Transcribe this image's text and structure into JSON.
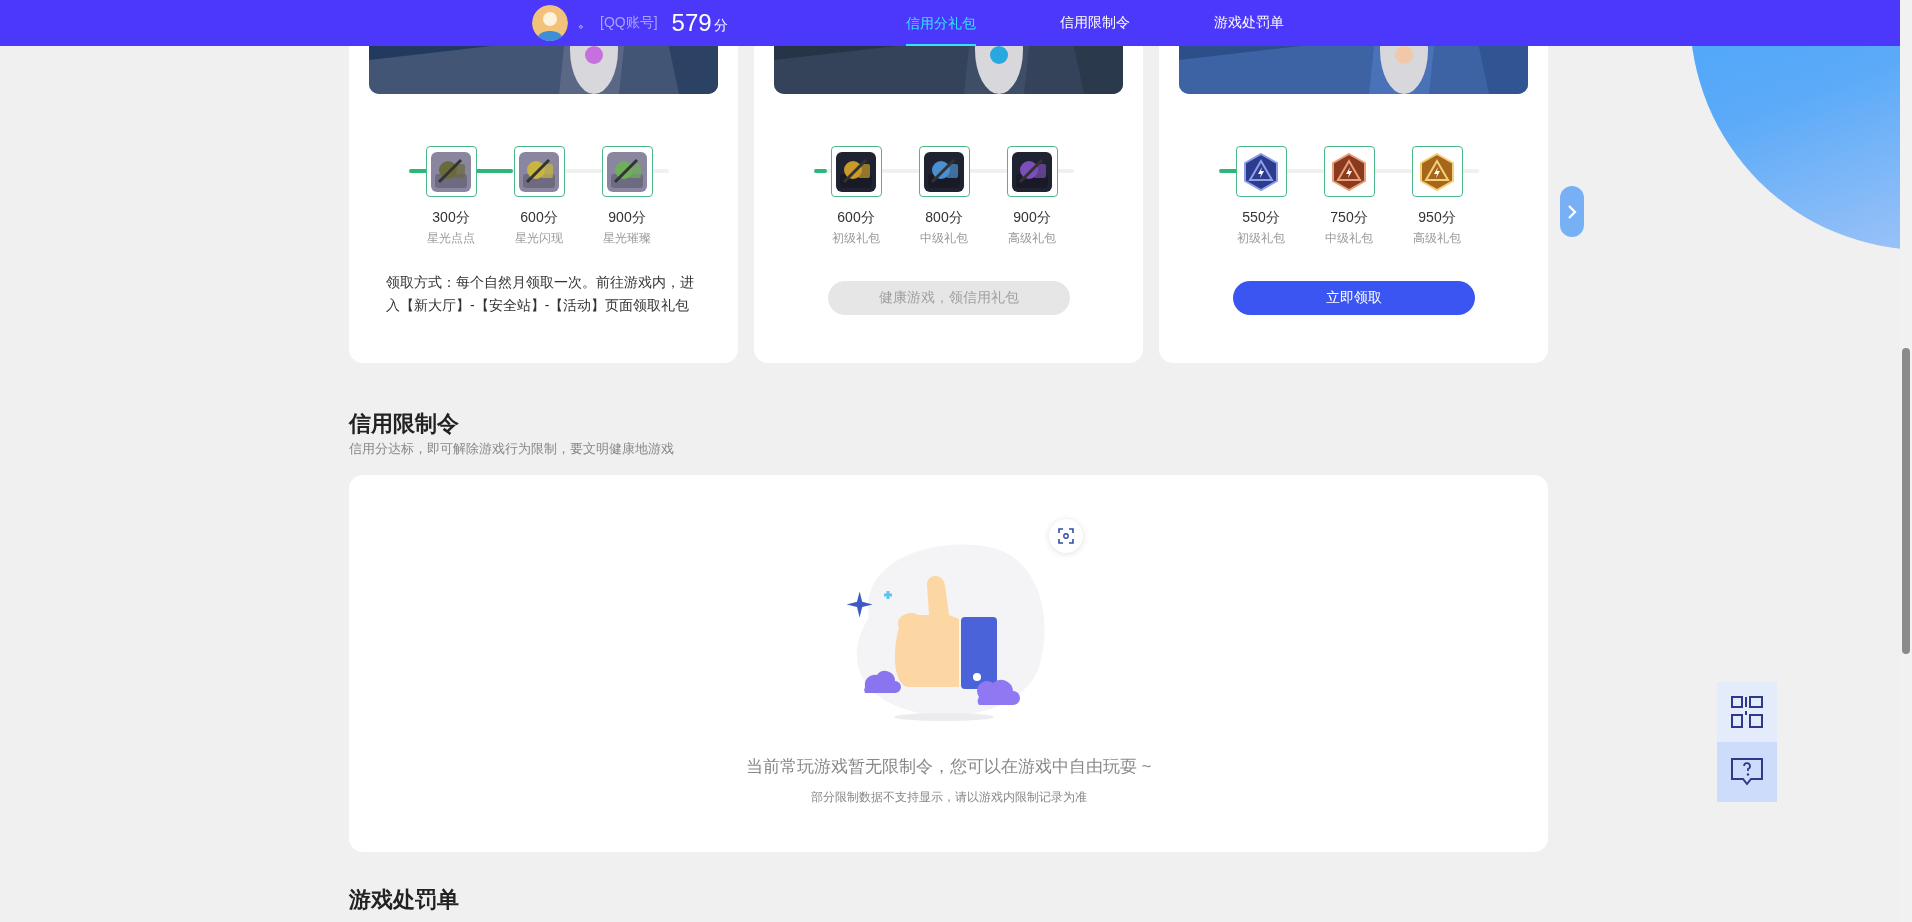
{
  "header": {
    "account_mark": "。",
    "account_label": "[QQ账号]",
    "score": "579",
    "score_unit": "分",
    "tabs": [
      {
        "label": "信用分礼包",
        "selected": true
      },
      {
        "label": "信用限制令",
        "selected": false
      },
      {
        "label": "游戏处罚单",
        "selected": false
      }
    ]
  },
  "gift_cards": [
    {
      "level": 0.4,
      "rewards": [
        {
          "score": "300分",
          "name": "星光点点"
        },
        {
          "score": "600分",
          "name": "星光闪现"
        },
        {
          "score": "900分",
          "name": "星光璀璨"
        }
      ],
      "note": "领取方式：每个自然月领取一次。前往游戏内，进入【新大厅】-【安全站】-【活动】页面领取礼包"
    },
    {
      "level": 0.05,
      "rewards": [
        {
          "score": "600分",
          "name": "初级礼包"
        },
        {
          "score": "800分",
          "name": "中级礼包"
        },
        {
          "score": "900分",
          "name": "高级礼包"
        }
      ],
      "button": {
        "label": "健康游戏，领信用礼包",
        "disabled": true
      }
    },
    {
      "level": 0.26,
      "rewards": [
        {
          "score": "550分",
          "name": "初级礼包"
        },
        {
          "score": "750分",
          "name": "中级礼包"
        },
        {
          "score": "950分",
          "name": "高级礼包"
        }
      ],
      "button": {
        "label": "立即领取",
        "disabled": false
      }
    }
  ],
  "limit_section": {
    "title": "信用限制令",
    "subtitle": "信用分达标，即可解除游戏行为限制，要文明健康地游戏",
    "empty_message": "当前常玩游戏暂无限制令，您可以在游戏中自由玩耍 ~",
    "empty_note": "部分限制数据不支持显示，请以游戏内限制记录为准"
  },
  "penalty_section": {
    "title": "游戏处罚单"
  }
}
